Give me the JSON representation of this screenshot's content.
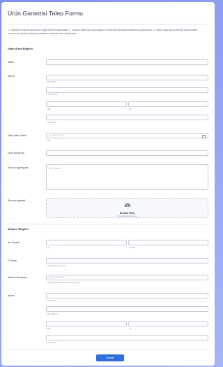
{
  "form": {
    "title": "Ürün Garantisi Talep Formu",
    "description": "1. Gönderimi kişisel çalışma ile bağlı eşleme aktarmadır. 2. Garanti talebi için sorunlağınızı problemin görüşlerindekimeniz gözüntünüz. 3. İstedi vaya ayrıca bilerşe kurulil istiten formunu bir görünü talepleri rastlalnma haberlermiz sahinlinadır.",
    "submit_label": "Gönder"
  },
  "sections": {
    "purchase_title": "Satın Alma Bilgileri",
    "customer_title": "Müşteri Bilgileri"
  },
  "purchase": {
    "seller_label": "Satıcı",
    "address_label": "Adres",
    "address_line1": "Adres Satırı",
    "address_line2": "Adres Satırı 2",
    "city": "Şehir",
    "state": "İlçe",
    "postal_code": "Posta Kodu",
    "date_label": "Satın Alma Tarihi",
    "date_placeholder": "DD-MM-YYYY",
    "date_sub": "Tarih",
    "product_code_label": "Ürün Kimlik No",
    "issue_label": "Sorunu açıklayınız",
    "issue_placeholder": "Metni yazın...",
    "photo_label": "Sorunun görseli",
    "browse_label": "Browse Files",
    "drag_label": "Drag and drop files here"
  },
  "customer": {
    "name_label": "Ad Soyadı",
    "first_sub": "Ad",
    "last_sub": "Soyadı",
    "email_label": "E-Posta",
    "email_sub": "example@example.com",
    "phone_label": "Telefon Numarası",
    "phone_placeholder": "(000) 000-0000",
    "phone_sub": "Lütfen geçerli bir telefon numarası giriniz.",
    "address_label": "Adres",
    "address_line1": "Adres Satırı",
    "address_line2": "Adres Satırı 2",
    "city": "Şehir",
    "state": "İlçe",
    "postal_code": "Posta Kodu"
  },
  "icons": {
    "calendar": "calendar-icon",
    "upload": "cloud-upload-icon"
  },
  "colors": {
    "background": "#8b9cf2",
    "accent": "#2f6fe0"
  }
}
